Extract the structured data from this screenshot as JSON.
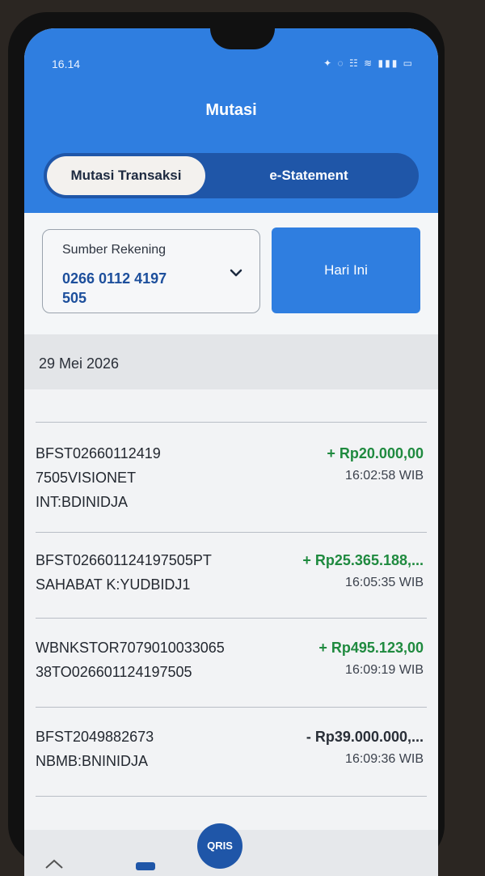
{
  "status_bar": {
    "time": "16.14",
    "indicators": "✦ ◌ ☷ ≋ ▮▮▮ ▭"
  },
  "header": {
    "title": "Mutasi"
  },
  "tabs": [
    {
      "label": "Mutasi Transaksi",
      "active": true
    },
    {
      "label": "e-Statement",
      "active": false
    }
  ],
  "account": {
    "label": "Sumber Rekening",
    "number": "0266 0112 4197 505"
  },
  "filter": {
    "period_label": "Hari Ini"
  },
  "date_header": "29 Mei 2026",
  "transactions": [
    {
      "description": "BFST02660112419\n7505VISIONET\nINT:BDINIDJA",
      "amount": "+ Rp20.000,00",
      "time": "16:02:58 WIB",
      "type": "credit"
    },
    {
      "description": "BFST026601124197505PT\nSAHABAT K:YUDBIDJ1",
      "amount": "+ Rp25.365.188,...",
      "time": "16:05:35 WIB",
      "type": "credit"
    },
    {
      "description": "WBNKSTOR7079010033065\n38TO026601124197505",
      "amount": "+ Rp495.123,00",
      "time": "16:09:19 WIB",
      "type": "credit"
    },
    {
      "description": "BFST2049882673\nNBMB:BNINIDJA",
      "amount": "- Rp39.000.000,...",
      "time": "16:09:36 WIB",
      "type": "debit"
    }
  ],
  "bottom_nav": {
    "qris_label": "QRIS"
  },
  "colors": {
    "primary": "#2f7ee0",
    "primary_dark": "#1f56a8",
    "credit": "#1f8a3f"
  }
}
